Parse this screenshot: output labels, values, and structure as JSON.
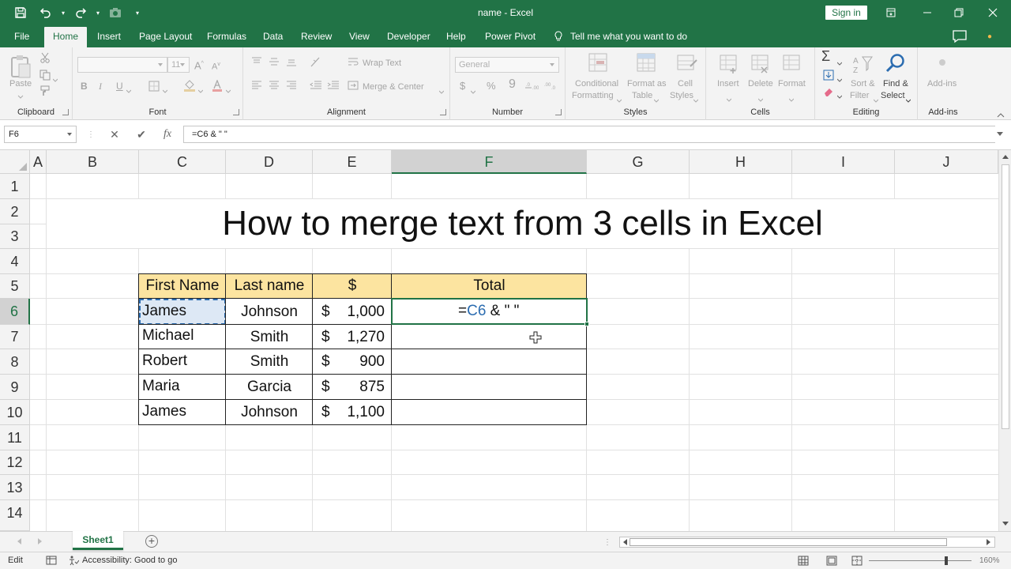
{
  "window": {
    "title": "name  -  Excel",
    "signin_label": "Sign in"
  },
  "tabs": [
    {
      "label": "File"
    },
    {
      "label": "Home"
    },
    {
      "label": "Insert"
    },
    {
      "label": "Page Layout"
    },
    {
      "label": "Formulas"
    },
    {
      "label": "Data"
    },
    {
      "label": "Review"
    },
    {
      "label": "View"
    },
    {
      "label": "Developer"
    },
    {
      "label": "Help"
    },
    {
      "label": "Power Pivot"
    }
  ],
  "tell_me": "Tell me what you want to do",
  "ribbon": {
    "clipboard": {
      "label": "Clipboard",
      "paste": "Paste"
    },
    "font": {
      "label": "Font",
      "size": "11",
      "bold": "B",
      "italic": "I",
      "underline": "U"
    },
    "alignment": {
      "label": "Alignment",
      "wrap_text": "Wrap Text",
      "merge_center": "Merge & Center"
    },
    "number": {
      "label": "Number",
      "format": "General",
      "currency": "$",
      "percent": "%"
    },
    "styles": {
      "label": "Styles",
      "conditional_1": "Conditional",
      "conditional_2": "Formatting",
      "format_table_1": "Format as",
      "format_table_2": "Table",
      "cell_styles_1": "Cell",
      "cell_styles_2": "Styles"
    },
    "cells": {
      "label": "Cells",
      "insert": "Insert",
      "delete": "Delete",
      "format": "Format"
    },
    "editing": {
      "label": "Editing",
      "sort_1": "Sort &",
      "sort_2": "Filter",
      "find_1": "Find &",
      "find_2": "Select"
    },
    "addins": {
      "label": "Add-ins",
      "addins_btn": "Add-ins"
    }
  },
  "formula_bar": {
    "name_box": "F6",
    "cancel": "✕",
    "enter": "✔",
    "fx": "fx",
    "formula": "=C6 & \" \""
  },
  "columns": [
    "A",
    "B",
    "C",
    "D",
    "E",
    "F",
    "G",
    "H",
    "I",
    "J"
  ],
  "rows": [
    "1",
    "2",
    "3",
    "4",
    "5",
    "6",
    "7",
    "8",
    "9",
    "10",
    "11",
    "12",
    "13",
    "14"
  ],
  "sheet_title": "How to merge text from 3 cells in Excel",
  "table": {
    "headers": [
      "First Name",
      "Last name",
      "$",
      "Total"
    ],
    "currency_symbol": "$",
    "rows": [
      {
        "first": "James",
        "last": "Johnson",
        "amount": "1,000"
      },
      {
        "first": "Michael",
        "last": "Smith",
        "amount": "1,270"
      },
      {
        "first": "Robert",
        "last": "Smith",
        "amount": "900"
      },
      {
        "first": "Maria",
        "last": "Garcia",
        "amount": "875"
      },
      {
        "first": "James",
        "last": "Johnson",
        "amount": "1,100"
      }
    ]
  },
  "editing_cell": {
    "prefix": "=",
    "ref": "C6",
    "suffix": " & \" \""
  },
  "sheets": [
    {
      "label": "Sheet1"
    }
  ],
  "add_sheet": "+",
  "status": {
    "mode": "Edit",
    "accessibility": "Accessibility: Good to go",
    "zoom": "160%"
  }
}
